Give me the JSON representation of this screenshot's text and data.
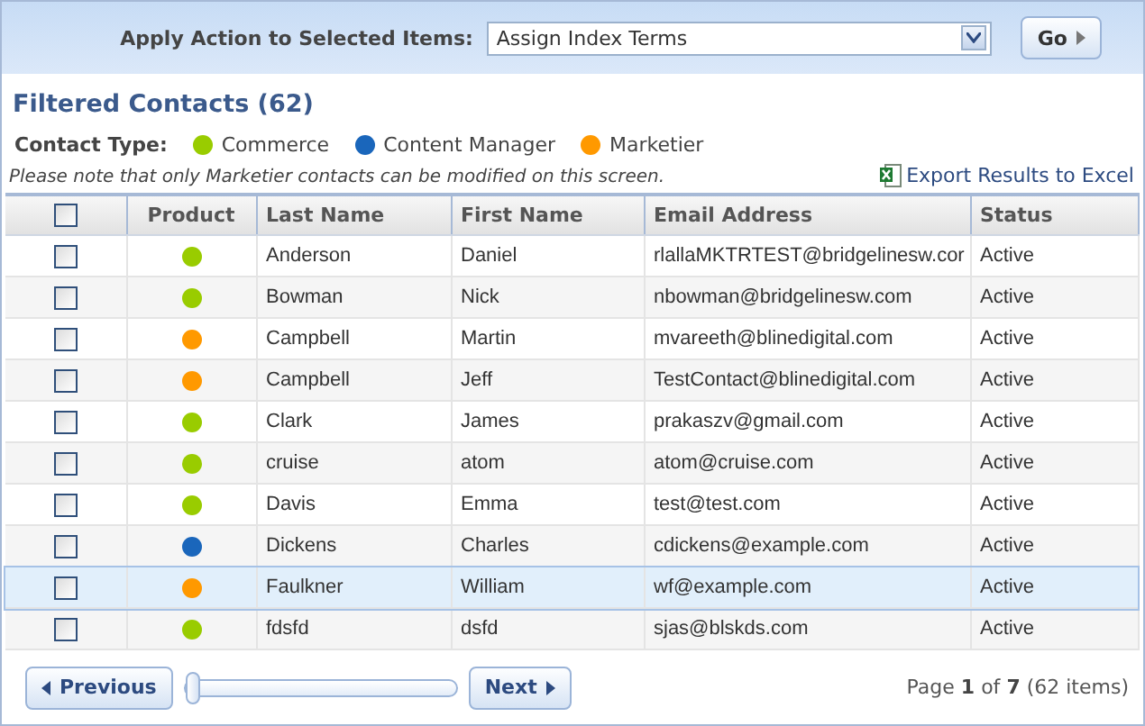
{
  "action_bar": {
    "label": "Apply Action to Selected Items:",
    "value": "Assign Index Terms",
    "button": "Go"
  },
  "title": "Filtered Contacts (62)",
  "legend": {
    "label": "Contact Type:",
    "items": [
      {
        "label": "Commerce",
        "color": "#99cc00"
      },
      {
        "label": "Content Manager",
        "color": "#1a66bb"
      },
      {
        "label": "Marketier",
        "color": "#ff9900"
      }
    ]
  },
  "note": "Please note that only Marketier contacts can be modified on this screen.",
  "export_link": "Export Results to Excel",
  "table": {
    "select_all_checked": false,
    "columns": [
      "Product",
      "Last Name",
      "First Name",
      "Email Address",
      "Status"
    ],
    "rows": [
      {
        "checked": false,
        "selected": false,
        "color": "#99cc00",
        "last": "Anderson",
        "first": "Daniel",
        "email": "rlallaMKTRTEST@bridgelinesw.cor",
        "status": "Active"
      },
      {
        "checked": false,
        "selected": false,
        "color": "#99cc00",
        "last": "Bowman",
        "first": "Nick",
        "email": "nbowman@bridgelinesw.com",
        "status": "Active"
      },
      {
        "checked": false,
        "selected": false,
        "color": "#ff9900",
        "last": "Campbell",
        "first": "Martin",
        "email": "mvareeth@blinedigital.com",
        "status": "Active"
      },
      {
        "checked": false,
        "selected": false,
        "color": "#ff9900",
        "last": "Campbell",
        "first": "Jeff",
        "email": "TestContact@blinedigital.com",
        "status": "Active"
      },
      {
        "checked": false,
        "selected": false,
        "color": "#99cc00",
        "last": "Clark",
        "first": "James",
        "email": "prakaszv@gmail.com",
        "status": "Active"
      },
      {
        "checked": false,
        "selected": false,
        "color": "#99cc00",
        "last": "cruise",
        "first": "atom",
        "email": "atom@cruise.com",
        "status": "Active"
      },
      {
        "checked": false,
        "selected": false,
        "color": "#99cc00",
        "last": "Davis",
        "first": "Emma",
        "email": "test@test.com",
        "status": "Active"
      },
      {
        "checked": false,
        "selected": false,
        "color": "#1a66bb",
        "last": "Dickens",
        "first": "Charles",
        "email": "cdickens@example.com",
        "status": "Active"
      },
      {
        "checked": false,
        "selected": true,
        "color": "#ff9900",
        "last": "Faulkner",
        "first": "William",
        "email": "wf@example.com",
        "status": "Active"
      },
      {
        "checked": false,
        "selected": false,
        "color": "#99cc00",
        "last": "fdsfd",
        "first": "dsfd",
        "email": "sjas@blskds.com",
        "status": "Active"
      }
    ]
  },
  "pager": {
    "previous": "Previous",
    "next": "Next",
    "level": 0,
    "summary": "Page **1** of **7** (62 items)"
  }
}
